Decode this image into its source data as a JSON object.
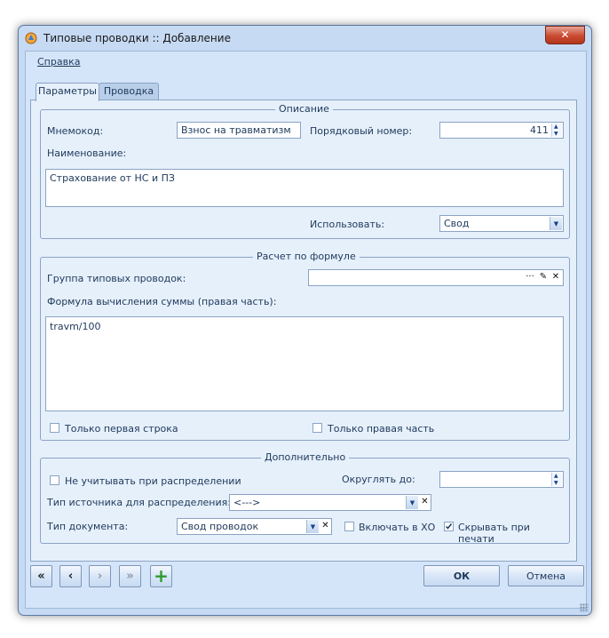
{
  "window": {
    "title": "Типовые проводки :: Добавление",
    "close_glyph": "✕"
  },
  "menu": {
    "help": "Справка"
  },
  "tabs": [
    {
      "label": "Параметры",
      "active": true
    },
    {
      "label": "Проводка",
      "active": false
    }
  ],
  "description_group": {
    "title": "Описание",
    "mnemocode_label": "Мнемокод:",
    "mnemocode_value": "Взнос на травматизм",
    "order_label": "Порядковый номер:",
    "order_value": "411",
    "name_label": "Наименование:",
    "name_value": "Страхование от НС и ПЗ",
    "use_label": "Использовать:",
    "use_value": "Свод"
  },
  "formula_group": {
    "title": "Расчет по формуле",
    "group_label": "Группа типовых проводок:",
    "group_value": "",
    "formula_label": "Формула вычисления суммы (правая часть):",
    "formula_value": "travm/100",
    "first_row_only": {
      "label": "Только первая строка",
      "checked": false
    },
    "right_part_only": {
      "label": "Только правая часть",
      "checked": false
    }
  },
  "additional_group": {
    "title": "Дополнительно",
    "ignore_distribution": {
      "label": "Не учитывать при распределении",
      "checked": false
    },
    "round_label": "Округлять до:",
    "round_value": "",
    "source_type_label": "Тип источника для распределения:",
    "source_type_value": "<--->",
    "doc_type_label": "Тип документа:",
    "doc_type_value": "Свод проводок",
    "include_xo": {
      "label": "Включать в ХО",
      "checked": false
    },
    "hide_print": {
      "label": "Скрывать при печати",
      "checked": true
    }
  },
  "footer": {
    "first_glyph": "«",
    "prev_glyph": "‹",
    "next_glyph": "›",
    "last_glyph": "»",
    "add_glyph": "+",
    "ok_label": "ОК",
    "cancel_label": "Отмена"
  },
  "colors": {
    "accent_green": "#2e9a2e",
    "close_red": "#c94a31"
  }
}
